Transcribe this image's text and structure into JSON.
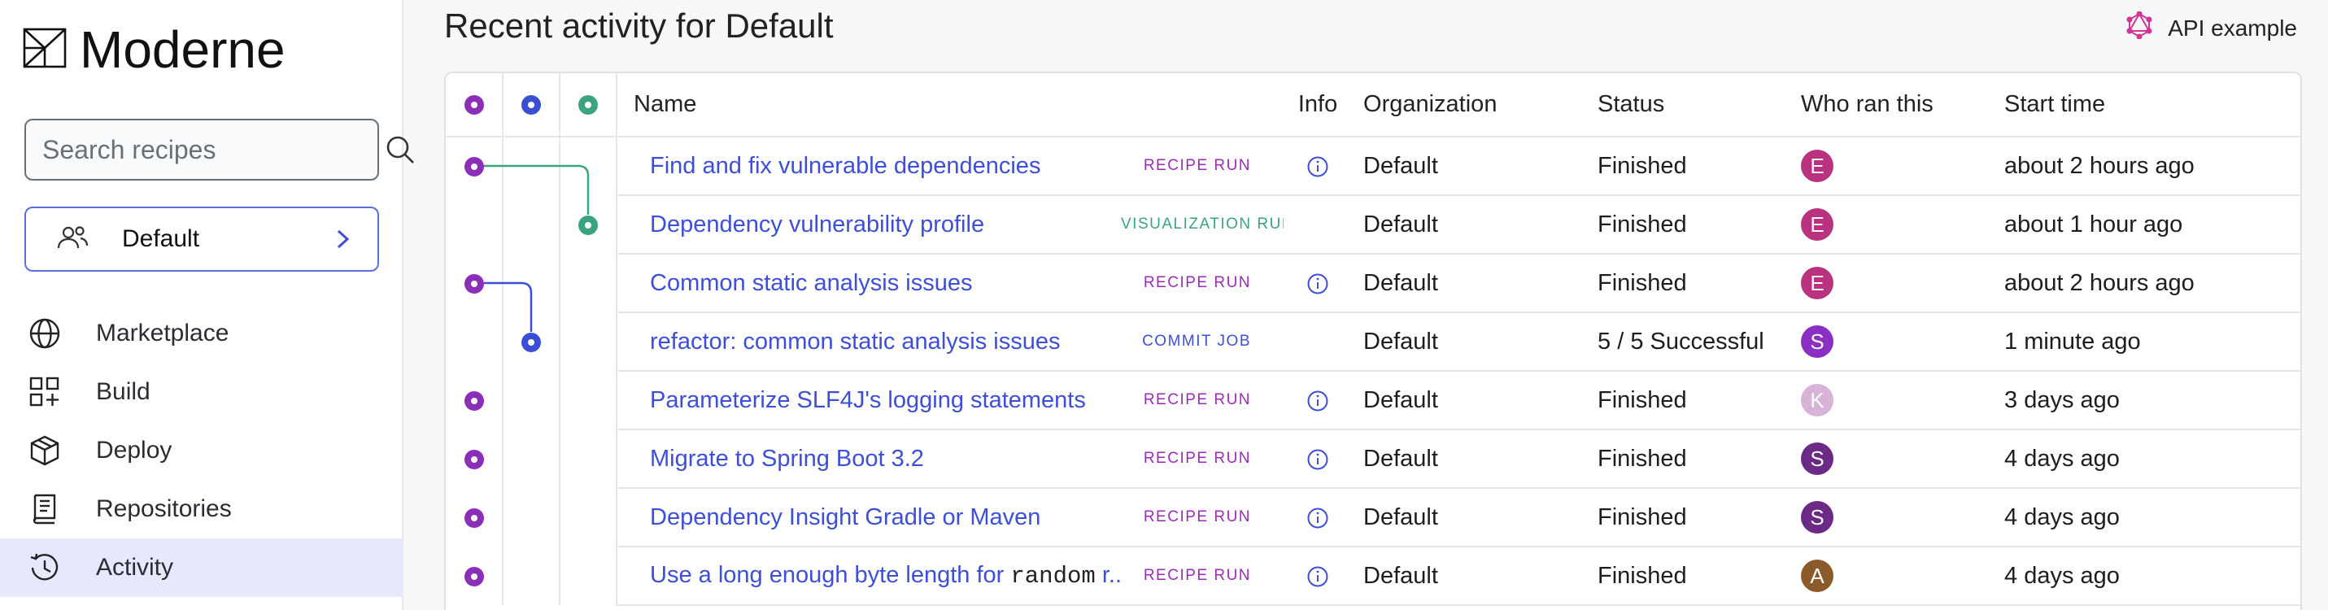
{
  "brand": {
    "name": "Moderne"
  },
  "search": {
    "placeholder": "Search recipes"
  },
  "org_selector": {
    "label": "Default"
  },
  "nav": {
    "items": [
      {
        "label": "Marketplace",
        "icon": "globe-icon"
      },
      {
        "label": "Build",
        "icon": "build-grid-icon"
      },
      {
        "label": "Deploy",
        "icon": "package-icon"
      },
      {
        "label": "Repositories",
        "icon": "repository-icon"
      },
      {
        "label": "Activity",
        "icon": "activity-clock-icon",
        "active": true
      }
    ]
  },
  "header": {
    "title": "Recent activity for Default",
    "api_example": "API example"
  },
  "table": {
    "columns": [
      "Name",
      "Info",
      "Organization",
      "Status",
      "Who ran this",
      "Start time"
    ],
    "rows": [
      {
        "name": "Find and fix vulnerable dependencies",
        "type": "RECIPE RUN",
        "info": true,
        "organization": "Default",
        "status": "Finished",
        "user": "E",
        "user_color": "#b8327f",
        "start": "about 2 hours ago"
      },
      {
        "name": "Dependency vulnerability profile",
        "type": "VISUALIZATION RUN",
        "info": false,
        "organization": "Default",
        "status": "Finished",
        "user": "E",
        "user_color": "#b8327f",
        "start": "about 1 hour ago"
      },
      {
        "name": "Common static analysis issues",
        "type": "RECIPE RUN",
        "info": true,
        "organization": "Default",
        "status": "Finished",
        "user": "E",
        "user_color": "#b8327f",
        "start": "about 2 hours ago"
      },
      {
        "name": "refactor: common static analysis issues",
        "type": "COMMIT JOB",
        "info": false,
        "organization": "Default",
        "status": "5 / 5 Successful",
        "user": "S",
        "user_color": "#8a2fc1",
        "start": "1 minute ago"
      },
      {
        "name": "Parameterize SLF4J's logging statements",
        "type": "RECIPE RUN",
        "info": true,
        "organization": "Default",
        "status": "Finished",
        "user": "K",
        "user_color": "#d8b3d8",
        "start": "3 days ago"
      },
      {
        "name": "Migrate to Spring Boot 3.2",
        "type": "RECIPE RUN",
        "info": true,
        "organization": "Default",
        "status": "Finished",
        "user": "S",
        "user_color": "#6b2a86",
        "start": "4 days ago"
      },
      {
        "name": "Dependency Insight Gradle or Maven",
        "type": "RECIPE RUN",
        "info": true,
        "organization": "Default",
        "status": "Finished",
        "user": "S",
        "user_color": "#6b2a86",
        "start": "4 days ago"
      },
      {
        "name_prefix": "Use a long enough byte length for ",
        "name_code": "random",
        "name_suffix": " r...",
        "type": "RECIPE RUN",
        "info": true,
        "organization": "Default",
        "status": "Finished",
        "user": "A",
        "user_color": "#8a5a2b",
        "start": "4 days ago"
      }
    ]
  },
  "colors": {
    "recipe_run": "#8b2fb8",
    "commit_job": "#3a4fd4",
    "visualization_run": "#3aa57d",
    "link": "#3d4fd6",
    "active_nav": "#e6e8fb"
  }
}
